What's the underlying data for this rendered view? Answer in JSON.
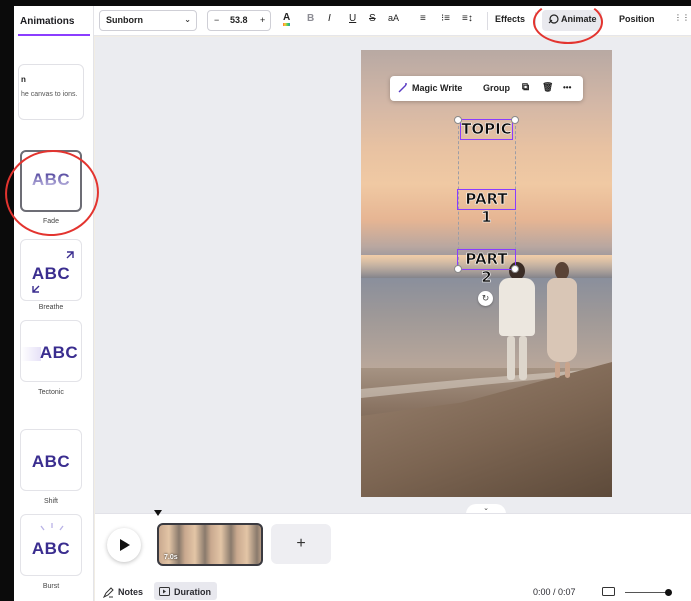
{
  "sidebar": {
    "title": "Animations",
    "hint": {
      "heading": "n",
      "text": "he canvas to ions."
    },
    "effects": [
      {
        "sample": "ABC",
        "label": "Fade",
        "selected": true
      },
      {
        "sample": "ABC",
        "label": "Breathe"
      },
      {
        "sample": "ABC",
        "label": "Tectonic"
      },
      {
        "sample": "ABC",
        "label": "Shift"
      },
      {
        "sample": "ABC",
        "label": "Burst"
      }
    ]
  },
  "toolbar": {
    "font": "Sunborn",
    "font_chevron": "⌄",
    "size_minus": "−",
    "size": "53.8",
    "size_plus": "+",
    "text_color_glyph": "A",
    "bold": "B",
    "italic": "I",
    "underline": "U",
    "strike": "S",
    "case": "aA",
    "align_glyph": "≡",
    "list_glyph": "⁝≡",
    "spacing_glyph": "≡↕",
    "effects": "Effects",
    "animate": "Animate",
    "position": "Position",
    "more_glyph": "⋮⋮"
  },
  "floating_toolbar": {
    "magic_write": "Magic Write",
    "group": "Group",
    "copy_glyph": "⧉",
    "delete_glyph": "🗑",
    "more": "•••"
  },
  "canvas_text": [
    "TOPIC",
    "PART 1",
    "PART 2"
  ],
  "rotate_glyph": "↻",
  "collapse_glyph": "⌄",
  "timeline": {
    "clip_duration": "7.0s",
    "add_glyph": "+",
    "notes": "Notes",
    "duration": "Duration",
    "timecode": "0:00 / 0:07"
  },
  "colors": {
    "accent": "#8b3dff",
    "annotation": "#e3342f",
    "effect_text": "#3a2d8f"
  }
}
